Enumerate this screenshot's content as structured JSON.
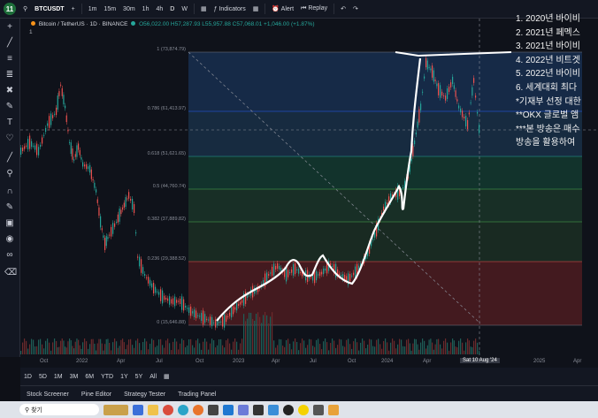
{
  "topbar": {
    "symbol": "BTCUSDT",
    "badge": "11",
    "intervals": [
      "1m",
      "15m",
      "30m",
      "1h",
      "4h",
      "D",
      "W"
    ],
    "indicators_label": "Indicators",
    "alert_label": "Alert",
    "replay_label": "Replay"
  },
  "legend": {
    "title": "Bitcoin / TetherUS · 1D · BINANCE",
    "ohlc": "O56,022.00 H57,287.93 L55,957.88 C57,068.01 +1,046.00 (+1.87%)",
    "sub": "1"
  },
  "fib_levels": [
    {
      "label": "1 (73,874.79)"
    },
    {
      "label": "0.786 (61,413.97)"
    },
    {
      "label": "0.618 (51,621.65)"
    },
    {
      "label": "0.5 (44,760.74)"
    },
    {
      "label": "0.382 (37,889.82)"
    },
    {
      "label": "0.236 (29,388.52)"
    },
    {
      "label": "0 (15,646.88)"
    }
  ],
  "xaxis": {
    "labels": [
      "Oct",
      "2022",
      "Apr",
      "Jul",
      "Oct",
      "2023",
      "Apr",
      "Jul",
      "Oct",
      "2024",
      "Apr",
      "2025",
      "Apr"
    ],
    "current": "Sat 10 Aug '24"
  },
  "ranges": [
    "1D",
    "5D",
    "1M",
    "3M",
    "6M",
    "YTD",
    "1Y",
    "5Y",
    "All"
  ],
  "panels": [
    "Stock Screener",
    "Pine Editor",
    "Strategy Tester",
    "Trading Panel"
  ],
  "taskbar": {
    "search_placeholder": "찾기"
  },
  "overlay_lines": [
    "1. 2020년 바이비",
    "2. 2021년 페멕스",
    "3. 2021년 바이비",
    "4. 2022년 비트겟",
    "5. 2022년 바이비",
    "6. 세계대회 최다",
    "*기재부 선정 대한",
    "**OKX 글로벌 앰",
    "***본 방송은 매수",
    " 방송을 활용하여"
  ],
  "colors": {
    "up": "#26a69a",
    "down": "#ef5350",
    "bg": "#0f121a",
    "panel": "#131722"
  }
}
